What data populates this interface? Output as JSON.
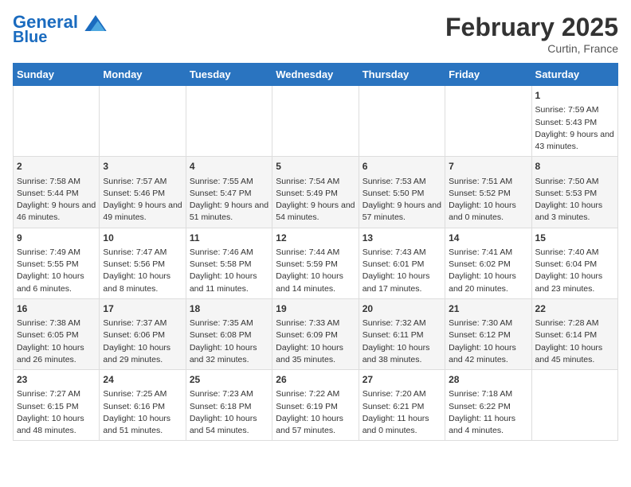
{
  "header": {
    "logo_line1": "General",
    "logo_line2": "Blue",
    "main_title": "February 2025",
    "subtitle": "Curtin, France"
  },
  "days_of_week": [
    "Sunday",
    "Monday",
    "Tuesday",
    "Wednesday",
    "Thursday",
    "Friday",
    "Saturday"
  ],
  "weeks": [
    [
      {
        "day": "",
        "info": ""
      },
      {
        "day": "",
        "info": ""
      },
      {
        "day": "",
        "info": ""
      },
      {
        "day": "",
        "info": ""
      },
      {
        "day": "",
        "info": ""
      },
      {
        "day": "",
        "info": ""
      },
      {
        "day": "1",
        "info": "Sunrise: 7:59 AM\nSunset: 5:43 PM\nDaylight: 9 hours and 43 minutes."
      }
    ],
    [
      {
        "day": "2",
        "info": "Sunrise: 7:58 AM\nSunset: 5:44 PM\nDaylight: 9 hours and 46 minutes."
      },
      {
        "day": "3",
        "info": "Sunrise: 7:57 AM\nSunset: 5:46 PM\nDaylight: 9 hours and 49 minutes."
      },
      {
        "day": "4",
        "info": "Sunrise: 7:55 AM\nSunset: 5:47 PM\nDaylight: 9 hours and 51 minutes."
      },
      {
        "day": "5",
        "info": "Sunrise: 7:54 AM\nSunset: 5:49 PM\nDaylight: 9 hours and 54 minutes."
      },
      {
        "day": "6",
        "info": "Sunrise: 7:53 AM\nSunset: 5:50 PM\nDaylight: 9 hours and 57 minutes."
      },
      {
        "day": "7",
        "info": "Sunrise: 7:51 AM\nSunset: 5:52 PM\nDaylight: 10 hours and 0 minutes."
      },
      {
        "day": "8",
        "info": "Sunrise: 7:50 AM\nSunset: 5:53 PM\nDaylight: 10 hours and 3 minutes."
      }
    ],
    [
      {
        "day": "9",
        "info": "Sunrise: 7:49 AM\nSunset: 5:55 PM\nDaylight: 10 hours and 6 minutes."
      },
      {
        "day": "10",
        "info": "Sunrise: 7:47 AM\nSunset: 5:56 PM\nDaylight: 10 hours and 8 minutes."
      },
      {
        "day": "11",
        "info": "Sunrise: 7:46 AM\nSunset: 5:58 PM\nDaylight: 10 hours and 11 minutes."
      },
      {
        "day": "12",
        "info": "Sunrise: 7:44 AM\nSunset: 5:59 PM\nDaylight: 10 hours and 14 minutes."
      },
      {
        "day": "13",
        "info": "Sunrise: 7:43 AM\nSunset: 6:01 PM\nDaylight: 10 hours and 17 minutes."
      },
      {
        "day": "14",
        "info": "Sunrise: 7:41 AM\nSunset: 6:02 PM\nDaylight: 10 hours and 20 minutes."
      },
      {
        "day": "15",
        "info": "Sunrise: 7:40 AM\nSunset: 6:04 PM\nDaylight: 10 hours and 23 minutes."
      }
    ],
    [
      {
        "day": "16",
        "info": "Sunrise: 7:38 AM\nSunset: 6:05 PM\nDaylight: 10 hours and 26 minutes."
      },
      {
        "day": "17",
        "info": "Sunrise: 7:37 AM\nSunset: 6:06 PM\nDaylight: 10 hours and 29 minutes."
      },
      {
        "day": "18",
        "info": "Sunrise: 7:35 AM\nSunset: 6:08 PM\nDaylight: 10 hours and 32 minutes."
      },
      {
        "day": "19",
        "info": "Sunrise: 7:33 AM\nSunset: 6:09 PM\nDaylight: 10 hours and 35 minutes."
      },
      {
        "day": "20",
        "info": "Sunrise: 7:32 AM\nSunset: 6:11 PM\nDaylight: 10 hours and 38 minutes."
      },
      {
        "day": "21",
        "info": "Sunrise: 7:30 AM\nSunset: 6:12 PM\nDaylight: 10 hours and 42 minutes."
      },
      {
        "day": "22",
        "info": "Sunrise: 7:28 AM\nSunset: 6:14 PM\nDaylight: 10 hours and 45 minutes."
      }
    ],
    [
      {
        "day": "23",
        "info": "Sunrise: 7:27 AM\nSunset: 6:15 PM\nDaylight: 10 hours and 48 minutes."
      },
      {
        "day": "24",
        "info": "Sunrise: 7:25 AM\nSunset: 6:16 PM\nDaylight: 10 hours and 51 minutes."
      },
      {
        "day": "25",
        "info": "Sunrise: 7:23 AM\nSunset: 6:18 PM\nDaylight: 10 hours and 54 minutes."
      },
      {
        "day": "26",
        "info": "Sunrise: 7:22 AM\nSunset: 6:19 PM\nDaylight: 10 hours and 57 minutes."
      },
      {
        "day": "27",
        "info": "Sunrise: 7:20 AM\nSunset: 6:21 PM\nDaylight: 11 hours and 0 minutes."
      },
      {
        "day": "28",
        "info": "Sunrise: 7:18 AM\nSunset: 6:22 PM\nDaylight: 11 hours and 4 minutes."
      },
      {
        "day": "",
        "info": ""
      }
    ]
  ]
}
